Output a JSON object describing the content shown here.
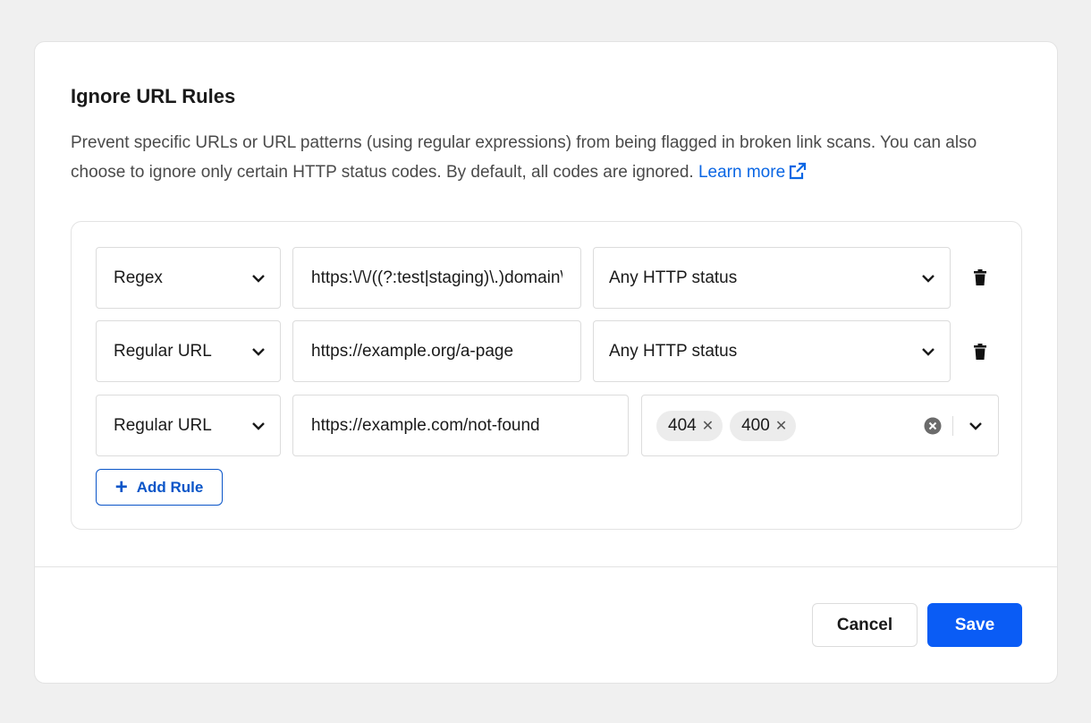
{
  "dialog": {
    "title": "Ignore URL Rules",
    "description": "Prevent specific URLs or URL patterns (using regular expressions) from being flagged in broken link scans. You can also choose to ignore only certain HTTP status codes. By default, all codes are ignored.",
    "learn_more": "Learn more"
  },
  "rules": [
    {
      "type": "Regex",
      "url": "https:\\/\\/((?:test|staging)\\.)domain\\.com",
      "status": "Any HTTP status"
    },
    {
      "type": "Regular URL",
      "url": "https://example.org/a-page",
      "status": "Any HTTP status"
    },
    {
      "type": "Regular URL",
      "url": "https://example.com/not-found",
      "status_codes": [
        "404",
        "400"
      ]
    }
  ],
  "add_rule_label": "Add Rule",
  "footer": {
    "cancel_label": "Cancel",
    "save_label": "Save"
  },
  "colors": {
    "accent": "#0a5cf5",
    "link": "#0a66e4"
  }
}
